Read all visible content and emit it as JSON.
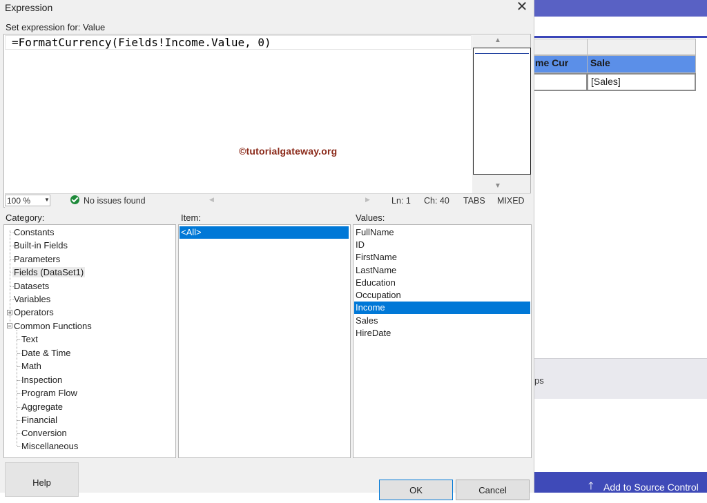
{
  "dialog": {
    "title": "Expression",
    "close_glyph": "✕",
    "set_expression_label": "Set expression for: Value",
    "expression": "=FormatCurrency(Fields!Income.Value, 0)",
    "watermark": "©tutorialgateway.org"
  },
  "status_bar": {
    "zoom": "100 %",
    "issues": "No issues found",
    "line": "Ln: 1",
    "column": "Ch: 40",
    "tabs": "TABS",
    "line_endings": "MIXED"
  },
  "category": {
    "label": "Category:",
    "items": [
      "Constants",
      "Built-in Fields",
      "Parameters",
      "Fields (DataSet1)",
      "Datasets",
      "Variables",
      "Operators",
      "Common Functions"
    ],
    "function_children": [
      "Text",
      "Date & Time",
      "Math",
      "Inspection",
      "Program Flow",
      "Aggregate",
      "Financial",
      "Conversion",
      "Miscellaneous"
    ],
    "selected": "Fields (DataSet1)"
  },
  "item": {
    "label": "Item:",
    "items": [
      "<All>"
    ],
    "selected": "<All>"
  },
  "values": {
    "label": "Values:",
    "items": [
      "FullName",
      "ID",
      "FirstName",
      "LastName",
      "Education",
      "Occupation",
      "Income",
      "Sales",
      "HireDate"
    ],
    "selected": "Income"
  },
  "buttons": {
    "help": "Help",
    "ok": "OK",
    "cancel": "Cancel"
  },
  "background": {
    "col1_header": "me Cur",
    "col2_header": "Sale",
    "col2_value": "[Sales]",
    "panel_text": "ps",
    "source_control": "Add to Source Control"
  },
  "colors": {
    "selection": "#0078d7",
    "header_blue": "#5b8fe8",
    "status_bar": "#3f4ab8",
    "title_bar": "#5961c4",
    "watermark": "#8b2a1a"
  }
}
